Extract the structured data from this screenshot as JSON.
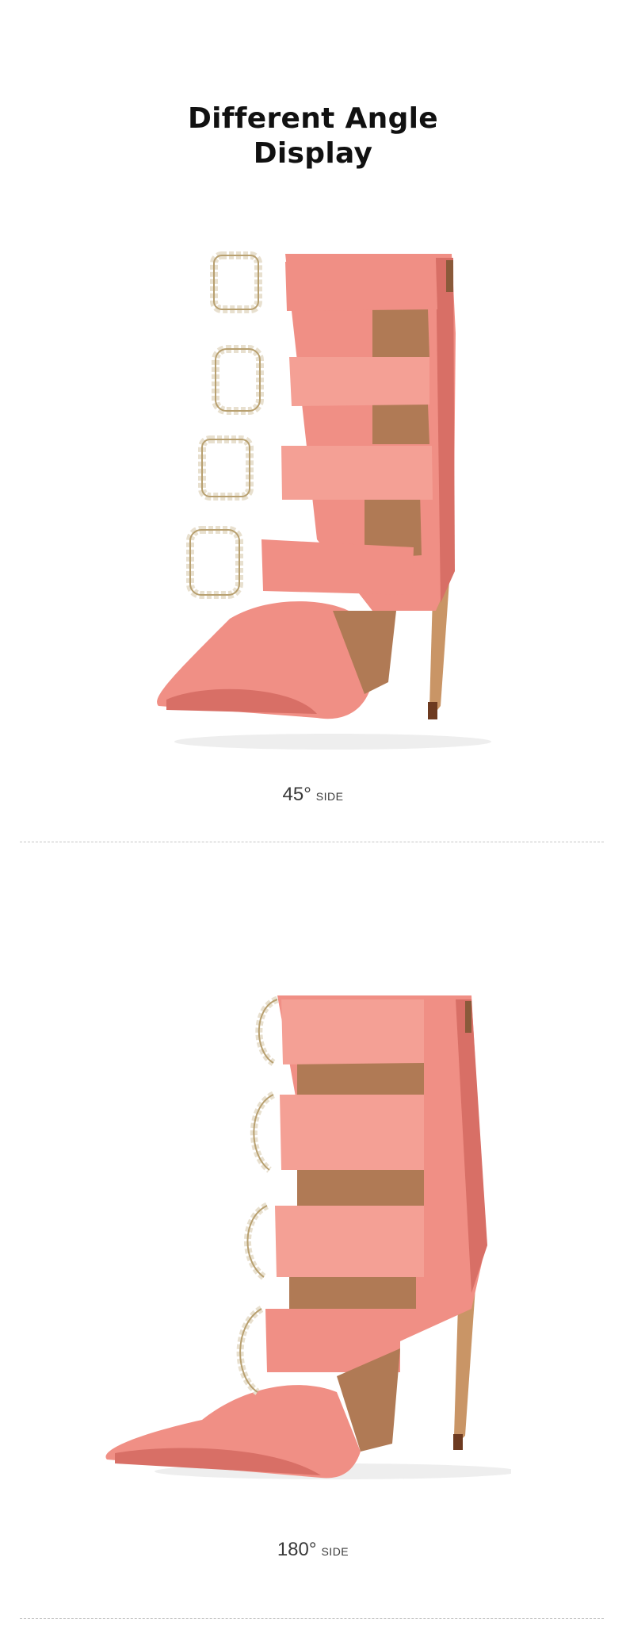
{
  "header": {
    "title_line1": "Different Angle",
    "title_line2": "Display"
  },
  "views": [
    {
      "degree": "45°",
      "side_label": "SIDE",
      "image_icon": "pink-satin-buckle-heel-45-view"
    },
    {
      "degree": "180°",
      "side_label": "SIDE",
      "image_icon": "pink-satin-buckle-heel-180-view"
    }
  ],
  "colors": {
    "satin": "#f08f85",
    "satin_dark": "#d86f66",
    "lining": "#b07a55",
    "heel": "#c99566",
    "crystal": "#e8e0cf",
    "divider": "#c6c6c6"
  }
}
